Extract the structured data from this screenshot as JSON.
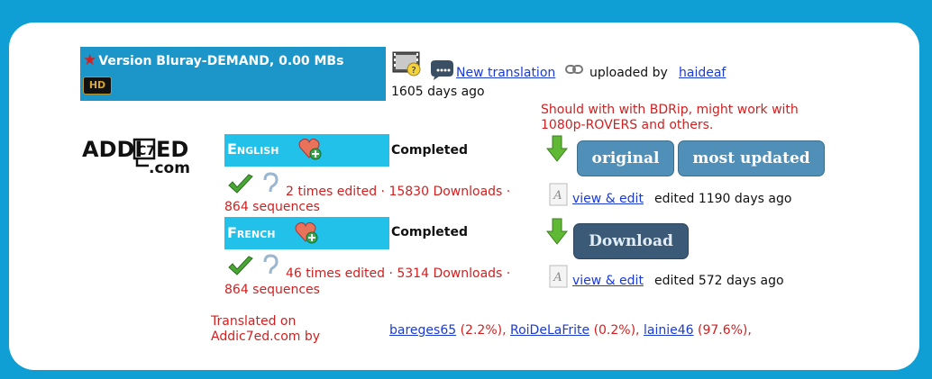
{
  "version": {
    "title": "Version Bluray-DEMAND, 0.00 MBs",
    "hd_badge": "HD"
  },
  "upload": {
    "new_translation": "New translation",
    "uploaded_by": "uploaded by",
    "uploader": "haideaf",
    "age": "1605 days ago"
  },
  "comment": "Should with with BDRip, might work with 1080p-ROVERS and others.",
  "logo": {
    "main": "ADDIC7ED",
    "sub": ".com"
  },
  "languages": [
    {
      "name": "English",
      "status": "Completed",
      "buttons": [
        "original",
        "most updated"
      ],
      "stats": "2 times edited · 15830 Downloads ·",
      "sequences": "864 sequences",
      "view_edit": "view & edit",
      "edited": "edited 1190 days ago"
    },
    {
      "name": "French",
      "status": "Completed",
      "buttons": [
        "Download"
      ],
      "stats": "46 times edited · 5314 Downloads ·",
      "sequences": "864 sequences",
      "view_edit": "view & edit",
      "edited": "edited 572 days ago"
    }
  ],
  "credits": {
    "label": "Translated on Addic7ed.com by",
    "contributors": [
      {
        "name": "bareges65",
        "share": "(2.2%),"
      },
      {
        "name": "RoiDeLaFrite",
        "share": "(0.2%),"
      },
      {
        "name": "lainie46",
        "share": "(97.6%),"
      }
    ]
  },
  "colors": {
    "frame_blue": "#0f9fd4",
    "lang_bar": "#22c1ea",
    "accent_red": "#d11f1f",
    "link_blue": "#1a3ad6"
  }
}
